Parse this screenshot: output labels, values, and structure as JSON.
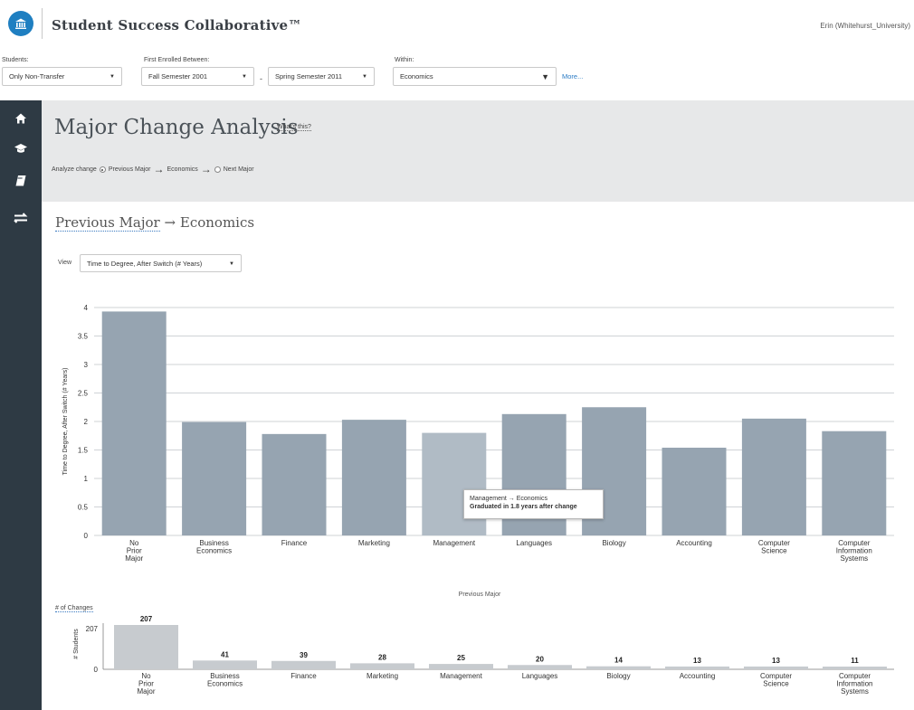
{
  "header": {
    "app_title": "Student Success Collaborative™",
    "user": "Erin (Whitehurst_University)"
  },
  "filters": {
    "students_label": "Students:",
    "students_value": "Only Non-Transfer",
    "enrolled_label": "First Enrolled Between:",
    "start_value": "Fall Semester 2001",
    "range_separator": "-",
    "end_value": "Spring Semester 2011",
    "within_label": "Within:",
    "within_value": "Economics",
    "more_link": "More..."
  },
  "sidebar": {
    "icons": [
      "home-icon",
      "graduation-cap-icon",
      "book-icon",
      "swap-arrows-icon"
    ]
  },
  "panel": {
    "title": "Major Change Analysis",
    "whats_this": "What's this?",
    "analyze_label": "Analyze change",
    "option_previous": "Previous Major",
    "major": "Economics",
    "option_next": "Next Major",
    "selected": "previous"
  },
  "section": {
    "previous_label": "Previous Major",
    "major": "Economics",
    "view_label": "View",
    "view_value": "Time to Degree, After Switch (# Years)"
  },
  "tooltip": {
    "line1": "Management → Economics",
    "line2": "Graduated in 1.8 years after change"
  },
  "bottom": {
    "changes_label": "# of Changes",
    "x_title": "Previous Major",
    "y_label": "# Students",
    "y_max_label": "207",
    "y_min_label": "0"
  },
  "colors": {
    "bar": "#96a4b1",
    "bar_highlight": "#b0bbc5",
    "count_bar": "#c7cbcf",
    "sidebar": "#2e3a44",
    "panel": "#e7e8e9",
    "accent": "#1f7fc1"
  },
  "chart_data": [
    {
      "type": "bar",
      "ylabel": "Time to Degree, After Switch (# Years)",
      "ylim": [
        0,
        4
      ],
      "yticks": [
        "0",
        "0.5",
        "1",
        "1.5",
        "2",
        "2.5",
        "3",
        "3.5",
        "4"
      ],
      "categories": [
        "No Prior Major",
        "Business Economics",
        "Finance",
        "Marketing",
        "Management",
        "Languages",
        "Biology",
        "Accounting",
        "Computer Science",
        "Computer Information Systems"
      ],
      "values": [
        3.93,
        1.99,
        1.78,
        2.03,
        1.8,
        2.13,
        2.25,
        1.54,
        2.05,
        1.83
      ],
      "highlighted": "Management",
      "grid": true
    },
    {
      "type": "bar",
      "xlabel": "Previous Major",
      "ylabel": "# Students",
      "categories": [
        "No Prior Major",
        "Business Economics",
        "Finance",
        "Marketing",
        "Management",
        "Languages",
        "Biology",
        "Accounting",
        "Computer Science",
        "Computer Information Systems"
      ],
      "values": [
        207,
        41,
        39,
        28,
        25,
        20,
        14,
        13,
        13,
        11
      ]
    }
  ]
}
